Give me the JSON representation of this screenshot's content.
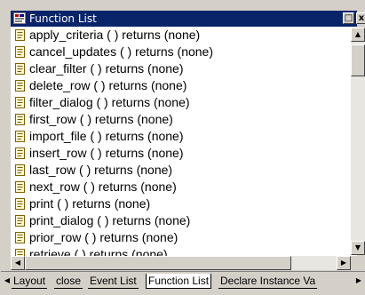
{
  "window": {
    "title": "Function List",
    "restore_glyph": "□",
    "close_glyph": "x"
  },
  "functions": [
    {
      "label": "apply_criteria ( ) returns (none)"
    },
    {
      "label": "cancel_updates ( ) returns (none)"
    },
    {
      "label": "clear_filter ( ) returns (none)"
    },
    {
      "label": "delete_row ( ) returns (none)"
    },
    {
      "label": "filter_dialog ( ) returns (none)"
    },
    {
      "label": "first_row ( ) returns (none)"
    },
    {
      "label": "import_file ( ) returns (none)"
    },
    {
      "label": "insert_row ( ) returns (none)"
    },
    {
      "label": "last_row ( ) returns (none)"
    },
    {
      "label": "next_row ( ) returns (none)"
    },
    {
      "label": "print ( ) returns (none)"
    },
    {
      "label": "print_dialog ( ) returns (none)"
    },
    {
      "label": "prior_row ( ) returns (none)"
    },
    {
      "label": "retrieve ( ) returns (none)"
    }
  ],
  "scroll": {
    "up": "▲",
    "down": "▼",
    "left": "◀",
    "right": "▶"
  },
  "tabs": {
    "prev": "◀",
    "next": "▶",
    "items": [
      {
        "label": "Layout"
      },
      {
        "label": "close"
      },
      {
        "label": "Event List"
      },
      {
        "label": "Function List"
      },
      {
        "label": "Declare Instance Va"
      }
    ],
    "active": "Function List"
  },
  "colors": {
    "titlebar": "#0a246a",
    "face": "#d4d0c8",
    "list_bg": "#ffffff"
  },
  "icons": {
    "title": "function-list-icon",
    "row": "function-icon"
  }
}
